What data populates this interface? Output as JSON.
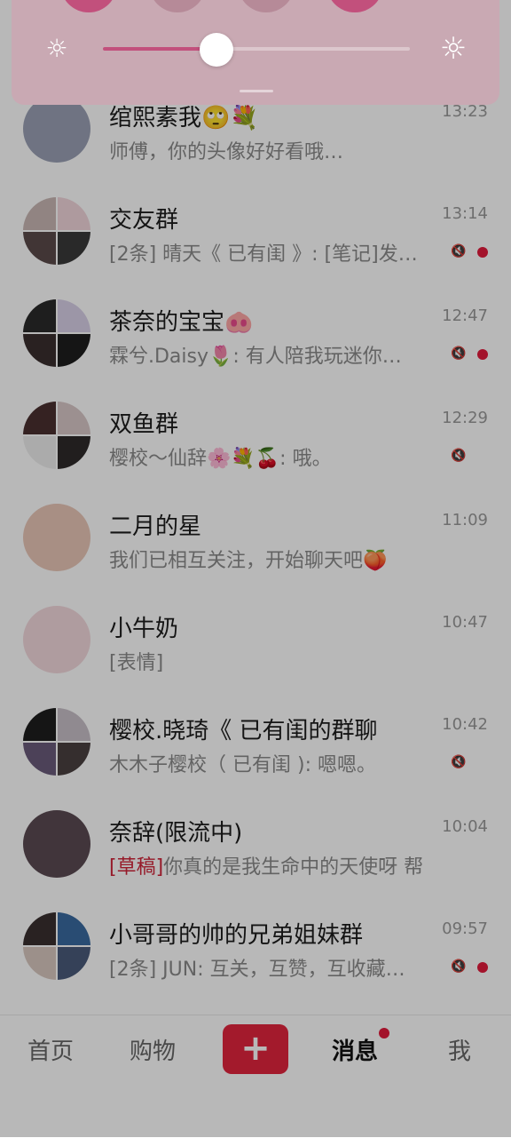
{
  "quick_panel": {
    "brightness_level": 0.37,
    "accent": "#c2507c",
    "icons": [
      "sun-low-icon",
      "sun-high-icon"
    ]
  },
  "chats": [
    {
      "name": "绾熙素我🙄💐",
      "preview": "师傅，你的头像好好看哦…",
      "time": "13:23",
      "muted": false,
      "unread": false,
      "draft": ""
    },
    {
      "name": "交友群",
      "preview": "[2条] 晴天《 已有闺 》: [笔记]发…",
      "time": "13:14",
      "muted": true,
      "unread": true,
      "draft": ""
    },
    {
      "name": "茶奈的宝宝🐽",
      "preview": "霖兮.Daisy🌷: 有人陪我玩迷你…",
      "time": "12:47",
      "muted": true,
      "unread": true,
      "draft": ""
    },
    {
      "name": "双鱼群",
      "preview": "樱校～仙辞🌸💐🍒: 哦。",
      "time": "12:29",
      "muted": true,
      "unread": false,
      "draft": ""
    },
    {
      "name": "二月的星",
      "preview": "我们已相互关注，开始聊天吧🍑",
      "time": "11:09",
      "muted": false,
      "unread": false,
      "draft": ""
    },
    {
      "name": "小牛奶",
      "preview": "[表情]",
      "time": "10:47",
      "muted": false,
      "unread": false,
      "draft": ""
    },
    {
      "name": "樱校.晓琦《 已有闺的群聊",
      "preview": "木木子樱校（ 已有闺 ): 嗯嗯。",
      "time": "10:42",
      "muted": true,
      "unread": false,
      "draft": ""
    },
    {
      "name": "奈辞(限流中)",
      "preview": "你真的是我生命中的天使呀 帮…",
      "time": "10:04",
      "muted": false,
      "unread": false,
      "draft": "[草稿]"
    },
    {
      "name": "小哥哥的帅的兄弟姐妹群",
      "preview": "[2条] JUN: 互关，互赞，互收藏…",
      "time": "09:57",
      "muted": true,
      "unread": true,
      "draft": ""
    }
  ],
  "nav": {
    "home": "首页",
    "shop": "购物",
    "plus": "+",
    "messages": "消息",
    "me": "我",
    "active": "消息"
  }
}
